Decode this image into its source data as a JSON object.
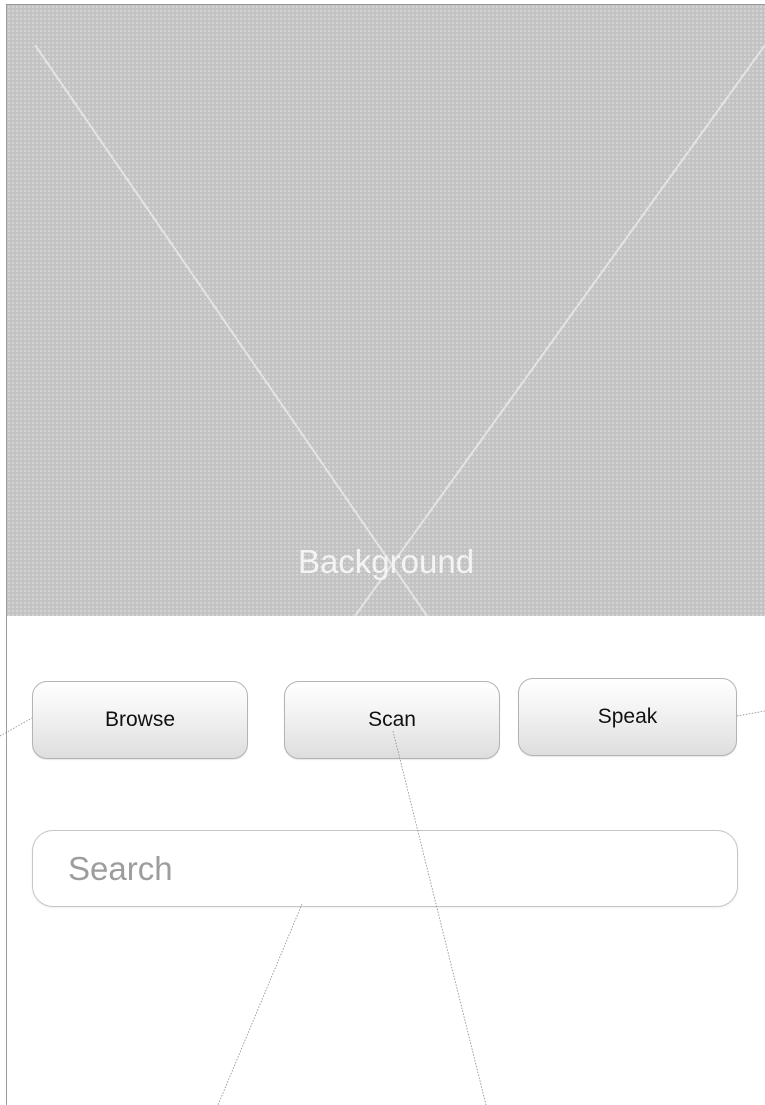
{
  "background": {
    "label": "Background",
    "fill_color": "#c3c3c3"
  },
  "actions": {
    "browse_label": "Browse",
    "scan_label": "Scan",
    "speak_label": "Speak"
  },
  "search": {
    "placeholder": "Search",
    "value": ""
  }
}
